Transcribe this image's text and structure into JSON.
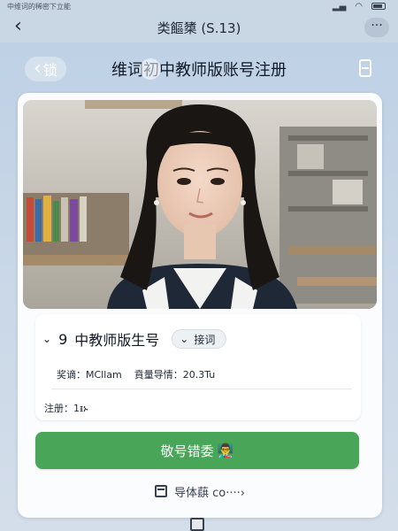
{
  "status_bar": {
    "left_text": "中维词的稀密下立能"
  },
  "nav": {
    "title": "类饇橥 (S.13)",
    "back_glyph": "‹",
    "more_glyph": "···"
  },
  "header": {
    "back_label": "锁",
    "title": "维词初中教师版账号注册"
  },
  "info": {
    "number": "9",
    "name": "中教师版生号",
    "badge_label": "接词",
    "field1": "奖谪：MCllam",
    "field2": "賁量导情：20.3Tu",
    "field3": "注册：1ᵻኑ"
  },
  "submit": {
    "label": "敬号错委",
    "emoji": "👨‍🏫"
  },
  "footer": {
    "link_text": "导体蕻 ᴄᴏ····›"
  },
  "colors": {
    "primary_green": "#49a658",
    "page_bg": "#c9d6e4"
  }
}
